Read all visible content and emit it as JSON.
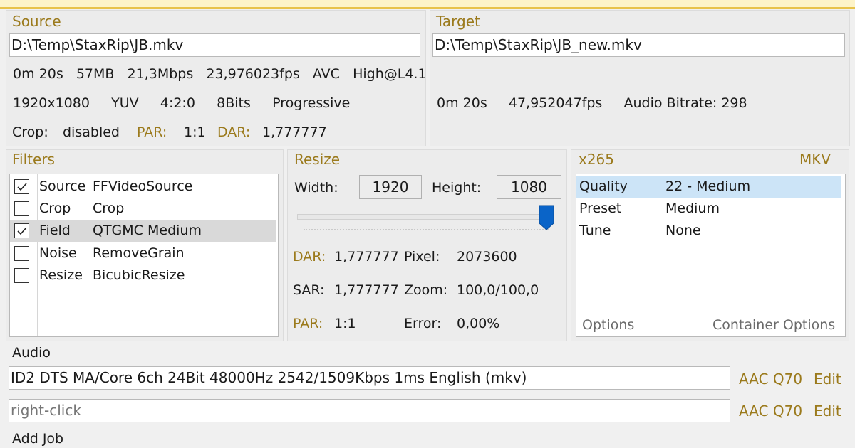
{
  "source": {
    "title": "Source",
    "path": "D:\\Temp\\StaxRip\\JB.mkv",
    "line1": "0m 20s   57MB   21,3Mbps   23,976023fps   AVC   High@L4.1",
    "line2": "1920x1080     YUV     4:2:0     8Bits     Progressive",
    "crop_label": "Crop:",
    "crop_value": "disabled",
    "par_label": "PAR:",
    "par_value": "1:1",
    "dar_label": "DAR:",
    "dar_value": "1,777777"
  },
  "target": {
    "title": "Target",
    "path": "D:\\Temp\\StaxRip\\JB_new.mkv",
    "info": "0m 20s     47,952047fps     Audio Bitrate: 298"
  },
  "filters": {
    "title": "Filters",
    "items": [
      {
        "category": "Source",
        "name": "FFVideoSource",
        "checked": true
      },
      {
        "category": "Crop",
        "name": "Crop",
        "checked": false
      },
      {
        "category": "Field",
        "name": "QTGMC Medium",
        "checked": true
      },
      {
        "category": "Noise",
        "name": "RemoveGrain",
        "checked": false
      },
      {
        "category": "Resize",
        "name": "BicubicResize",
        "checked": false
      }
    ]
  },
  "resize": {
    "title": "Resize",
    "width_label": "Width:",
    "width_value": "1920",
    "height_label": "Height:",
    "height_value": "1080",
    "slider_level": 0.97,
    "dar_label": "DAR:",
    "dar_value": "1,777777",
    "pixel_label": "Pixel:",
    "pixel_value": "2073600",
    "sar_label": "SAR:",
    "sar_value": "1,777777",
    "zoom_label": "Zoom:",
    "zoom_value": "100,0/100,0",
    "par_label": "PAR:",
    "par_value": "1:1",
    "error_label": "Error:",
    "error_value": "0,00%"
  },
  "encoder": {
    "title": "x265",
    "container": "MKV",
    "rows": [
      {
        "name": "Quality",
        "value": "22 - Medium"
      },
      {
        "name": "Preset",
        "value": "Medium"
      },
      {
        "name": "Tune",
        "value": "None"
      }
    ],
    "options_label": "Options",
    "container_options_label": "Container Options"
  },
  "audio": {
    "title": "Audio",
    "track1": "ID2 DTS MA/Core 6ch 24Bit 48000Hz 2542/1509Kbps 1ms English (mkv)",
    "track1_profile": "AAC Q70",
    "track1_edit": "Edit",
    "track2_placeholder": "right-click",
    "track2_profile": "AAC Q70",
    "track2_edit": "Edit"
  },
  "add_job": "Add Job",
  "colors": {
    "accent": "#9b7a1c",
    "slider": "#0a64c8",
    "selection": "#cce4f7"
  }
}
